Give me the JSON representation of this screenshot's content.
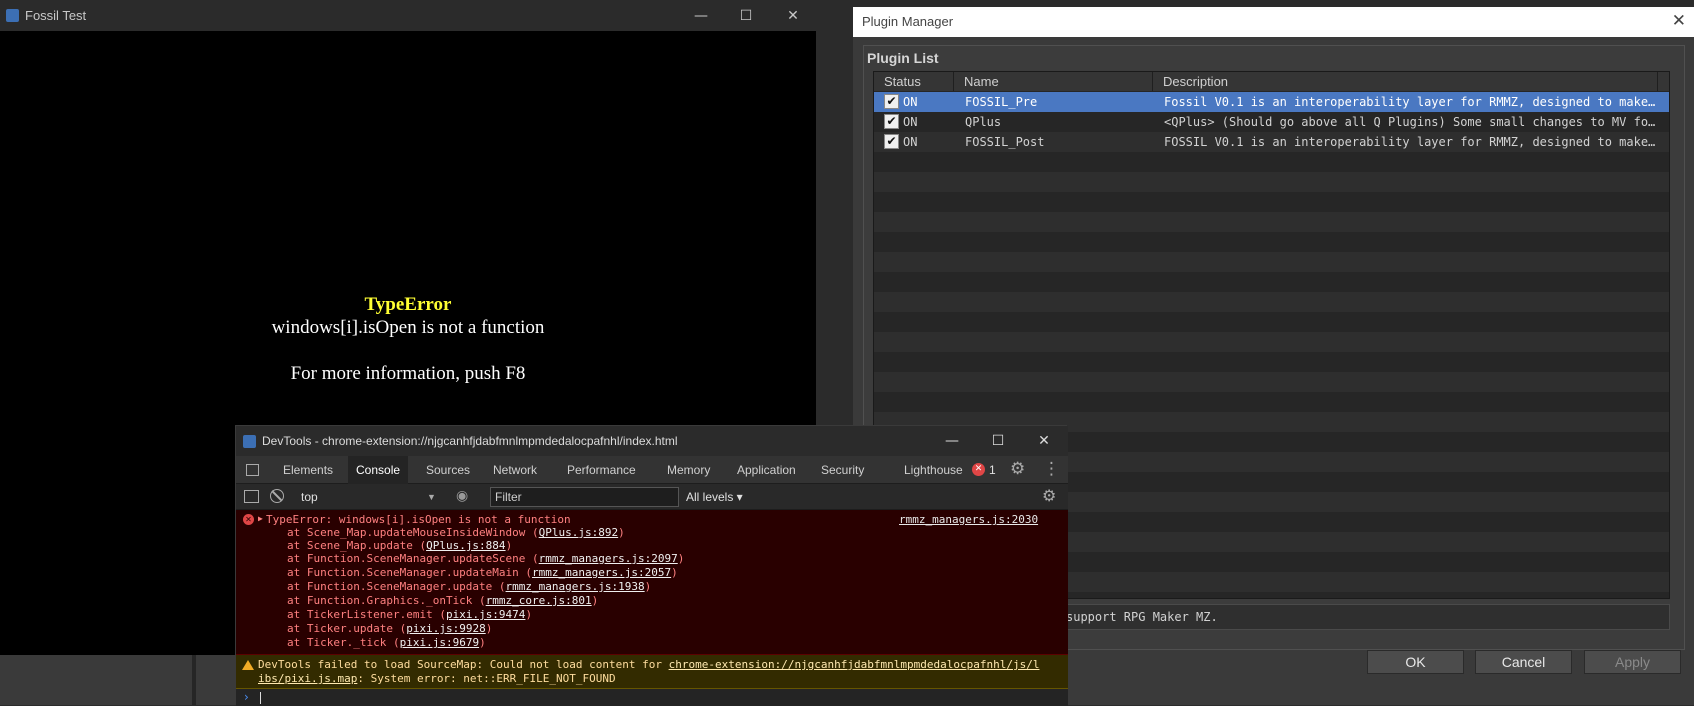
{
  "game_window": {
    "title": "Fossil Test",
    "controls": {
      "minimize": "—",
      "maximize": "☐",
      "close": "✕"
    },
    "error_title": "TypeError",
    "error_message": "windows[i].isOpen is not a function",
    "error_hint": "For more information, push F8"
  },
  "plugin_manager": {
    "title": "Plugin Manager",
    "close": "✕",
    "group_label": "Plugin List",
    "columns": [
      "Status",
      "Name",
      "Description"
    ],
    "rows": [
      {
        "check": "✔",
        "status": "ON",
        "name": "FOSSIL_Pre",
        "description": "Fossil V0.1 is an interoperability layer for RMMZ, designed to make…",
        "selected": true
      },
      {
        "check": "✔",
        "status": "ON",
        "name": "QPlus",
        "description": "<QPlus> (Should go above all Q Plugins) Some small changes to MV fo…",
        "selected": false
      },
      {
        "check": "✔",
        "status": "ON",
        "name": "FOSSIL_Post",
        "description": "FOSSIL V0.1 is an interoperability layer for RMMZ, designed to make…",
        "selected": false
      }
    ],
    "help_text": "support RPG Maker MZ.",
    "buttons": {
      "ok": "OK",
      "cancel": "Cancel",
      "apply": "Apply"
    }
  },
  "devtools": {
    "title": "DevTools - chrome-extension://njgcanhfjdabfmnlmpmdedalocpafnhl/index.html",
    "controls": {
      "minimize": "—",
      "maximize": "☐",
      "close": "✕"
    },
    "tabs": [
      "Elements",
      "Console",
      "Sources",
      "Network",
      "Performance",
      "Memory",
      "Application",
      "Security",
      "Lighthouse"
    ],
    "active_tab": "Console",
    "error_badge_count": "1",
    "toolbar": {
      "context": "top",
      "filter_placeholder": "Filter",
      "levels": "All levels ▾"
    },
    "error": {
      "headline": "TypeError: windows[i].isOpen is not a function",
      "source": "rmmz_managers.js:2030",
      "stack": [
        {
          "prefix": "at Scene_Map.updateMouseInsideWindow (",
          "link": "QPlus.js:892",
          "suffix": ")"
        },
        {
          "prefix": "at Scene_Map.update (",
          "link": "QPlus.js:884",
          "suffix": ")"
        },
        {
          "prefix": "at Function.SceneManager.updateScene (",
          "link": "rmmz_managers.js:2097",
          "suffix": ")"
        },
        {
          "prefix": "at Function.SceneManager.updateMain (",
          "link": "rmmz_managers.js:2057",
          "suffix": ")"
        },
        {
          "prefix": "at Function.SceneManager.update (",
          "link": "rmmz_managers.js:1938",
          "suffix": ")"
        },
        {
          "prefix": "at Function.Graphics._onTick (",
          "link": "rmmz_core.js:801",
          "suffix": ")"
        },
        {
          "prefix": "at TickerListener.emit (",
          "link": "pixi.js:9474",
          "suffix": ")"
        },
        {
          "prefix": "at Ticker.update (",
          "link": "pixi.js:9928",
          "suffix": ")"
        },
        {
          "prefix": "at Ticker._tick (",
          "link": "pixi.js:9679",
          "suffix": ")"
        }
      ]
    },
    "warning": {
      "prefix": "DevTools failed to load SourceMap: Could not load content for ",
      "link_part1": "chrome-extension://njgcanhfjdabfmnlmpmdedalocpafnhl/js/l",
      "link_part2": "ibs/pixi.js.map",
      "suffix": ": System error: net::ERR_FILE_NOT_FOUND"
    },
    "prompt": "›"
  },
  "colors": {
    "selection": "#4a78c2",
    "error_bg": "#290000",
    "warning_bg": "#332b00",
    "error_title": "#ffff33"
  }
}
